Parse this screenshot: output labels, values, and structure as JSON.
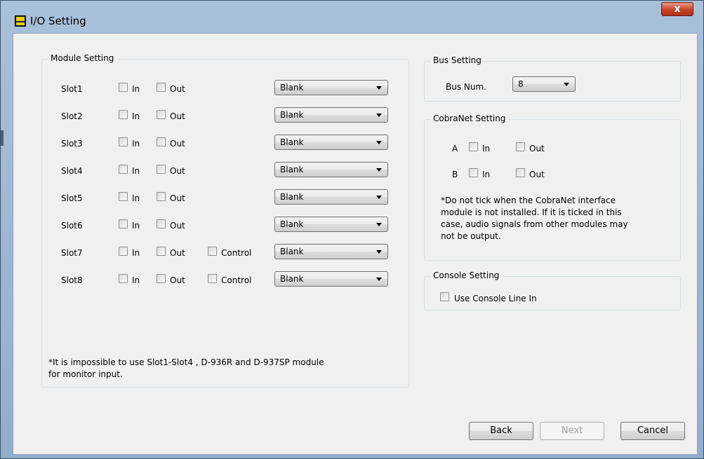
{
  "window": {
    "title": "I/O Setting",
    "close_glyph": "x"
  },
  "module_setting": {
    "legend": "Module Setting",
    "slots": [
      {
        "label": "Slot1",
        "in": "In",
        "out": "Out",
        "control": null,
        "select": "Blank"
      },
      {
        "label": "Slot2",
        "in": "In",
        "out": "Out",
        "control": null,
        "select": "Blank"
      },
      {
        "label": "Slot3",
        "in": "In",
        "out": "Out",
        "control": null,
        "select": "Blank"
      },
      {
        "label": "Slot4",
        "in": "In",
        "out": "Out",
        "control": null,
        "select": "Blank"
      },
      {
        "label": "Slot5",
        "in": "In",
        "out": "Out",
        "control": null,
        "select": "Blank"
      },
      {
        "label": "Slot6",
        "in": "In",
        "out": "Out",
        "control": null,
        "select": "Blank"
      },
      {
        "label": "Slot7",
        "in": "In",
        "out": "Out",
        "control": "Control",
        "select": "Blank"
      },
      {
        "label": "Slot8",
        "in": "In",
        "out": "Out",
        "control": "Control",
        "select": "Blank"
      }
    ],
    "note_line1": "*It is impossible to use Slot1-Slot4 , D-936R and D-937SP module",
    "note_line2": "for monitor input."
  },
  "bus_setting": {
    "legend": "Bus Setting",
    "label": "Bus Num.",
    "value": "8"
  },
  "cobranet_setting": {
    "legend": "CobraNet Setting",
    "rows": [
      {
        "label": "A",
        "in": "In",
        "out": "Out"
      },
      {
        "label": "B",
        "in": "In",
        "out": "Out"
      }
    ],
    "note_lines": [
      "*Do not tick when the CobraNet interface",
      "module is not installed. If it is ticked in this",
      "case, audio signals from other modules may",
      "not be output."
    ]
  },
  "console_setting": {
    "legend": "Console Setting",
    "checkbox_label": "Use Console Line In"
  },
  "buttons": {
    "back": "Back",
    "next": "Next",
    "cancel": "Cancel"
  }
}
